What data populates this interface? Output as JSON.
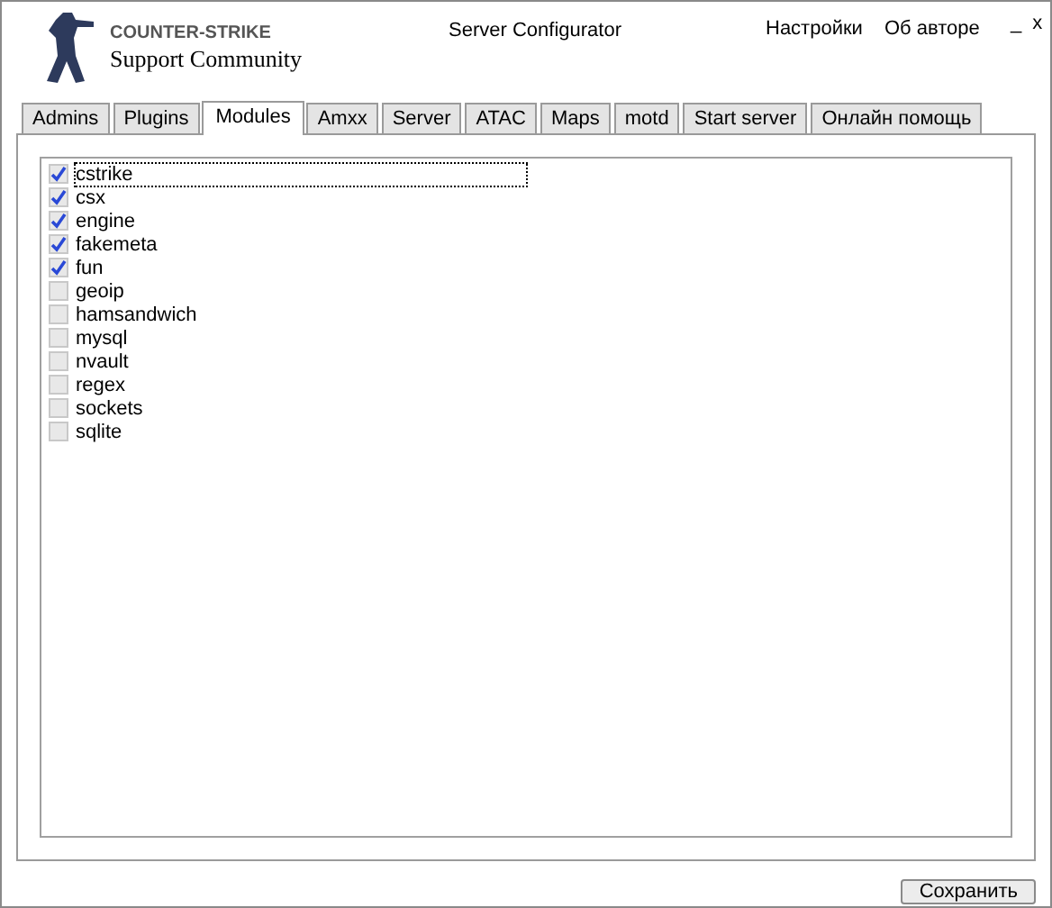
{
  "logo": {
    "title": "COUNTER-STRIKE",
    "subtitle": "Support Community"
  },
  "window": {
    "title": "Server Configurator"
  },
  "menu": [
    "Настройки",
    "Об авторе"
  ],
  "window_controls": [
    "_",
    "x"
  ],
  "tabs": [
    {
      "label": "Admins",
      "selected": false
    },
    {
      "label": "Plugins",
      "selected": false
    },
    {
      "label": "Modules",
      "selected": true
    },
    {
      "label": "Amxx",
      "selected": false
    },
    {
      "label": "Server",
      "selected": false
    },
    {
      "label": "ATAC",
      "selected": false
    },
    {
      "label": "Maps",
      "selected": false
    },
    {
      "label": "motd",
      "selected": false
    },
    {
      "label": "Start server",
      "selected": false
    },
    {
      "label": "Онлайн помощь",
      "selected": false
    }
  ],
  "modules": [
    {
      "name": "cstrike",
      "checked": true,
      "focused": true
    },
    {
      "name": "csx",
      "checked": true,
      "focused": false
    },
    {
      "name": "engine",
      "checked": true,
      "focused": false
    },
    {
      "name": "fakemeta",
      "checked": true,
      "focused": false
    },
    {
      "name": "fun",
      "checked": true,
      "focused": false
    },
    {
      "name": "geoip",
      "checked": false,
      "focused": false
    },
    {
      "name": "hamsandwich",
      "checked": false,
      "focused": false
    },
    {
      "name": "mysql",
      "checked": false,
      "focused": false
    },
    {
      "name": "nvault",
      "checked": false,
      "focused": false
    },
    {
      "name": "regex",
      "checked": false,
      "focused": false
    },
    {
      "name": "sockets",
      "checked": false,
      "focused": false
    },
    {
      "name": "sqlite",
      "checked": false,
      "focused": false
    }
  ],
  "save_button": "Сохранить"
}
